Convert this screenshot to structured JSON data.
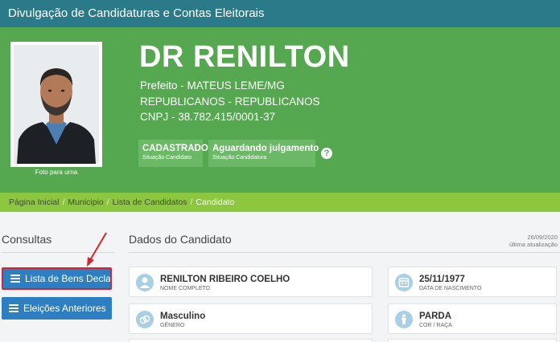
{
  "header": {
    "title": "Divulgação de Candidaturas e Contas Eleitorais"
  },
  "candidate": {
    "photo_caption": "Foto para urna",
    "name": "DR RENILTON",
    "office_line": "Prefeito - MATEUS LEME/MG",
    "party_line": "REPUBLICANOS - REPUBLICANOS",
    "cnpj_line": "CNPJ - 38.782.415/0001-37"
  },
  "status": [
    {
      "value": "CADASTRADO",
      "label": "Situação Candidato"
    },
    {
      "value": "Aguardando julgamento",
      "label": "Situação Candidatura"
    }
  ],
  "help_glyph": "?",
  "breadcrumb": {
    "separator": "/",
    "items": [
      "Página Inicial",
      "Municipio",
      "Lista de Candidatos"
    ],
    "active": "Candidato"
  },
  "sidebar": {
    "title": "Consultas",
    "buttons": [
      {
        "label": "Lista de Bens Declarados",
        "icon": "list-icon"
      },
      {
        "label": "Eleições Anteriores",
        "icon": "list-icon"
      }
    ]
  },
  "main": {
    "title": "Dados do Candidato",
    "update_date": "26/09/2020",
    "update_label": "última atualização",
    "fields": {
      "name": {
        "value": "RENILTON RIBEIRO COELHO",
        "label": "NOME COMPLETO",
        "icon": "user-icon"
      },
      "birth": {
        "value": "25/11/1977",
        "label": "DATA DE NASCIMENTO",
        "icon": "calendar-icon"
      },
      "gender": {
        "value": "Masculino",
        "label": "GÊNERO",
        "icon": "gender-icon"
      },
      "race": {
        "value": "PARDA",
        "label": "COR / RAÇA",
        "icon": "person-icon"
      }
    }
  },
  "colors": {
    "topbar": "#2b7a8a",
    "hero": "#55a84f",
    "breadcrumb": "#8dc63f",
    "button": "#2d7fc1",
    "highlight": "#d9232d"
  }
}
